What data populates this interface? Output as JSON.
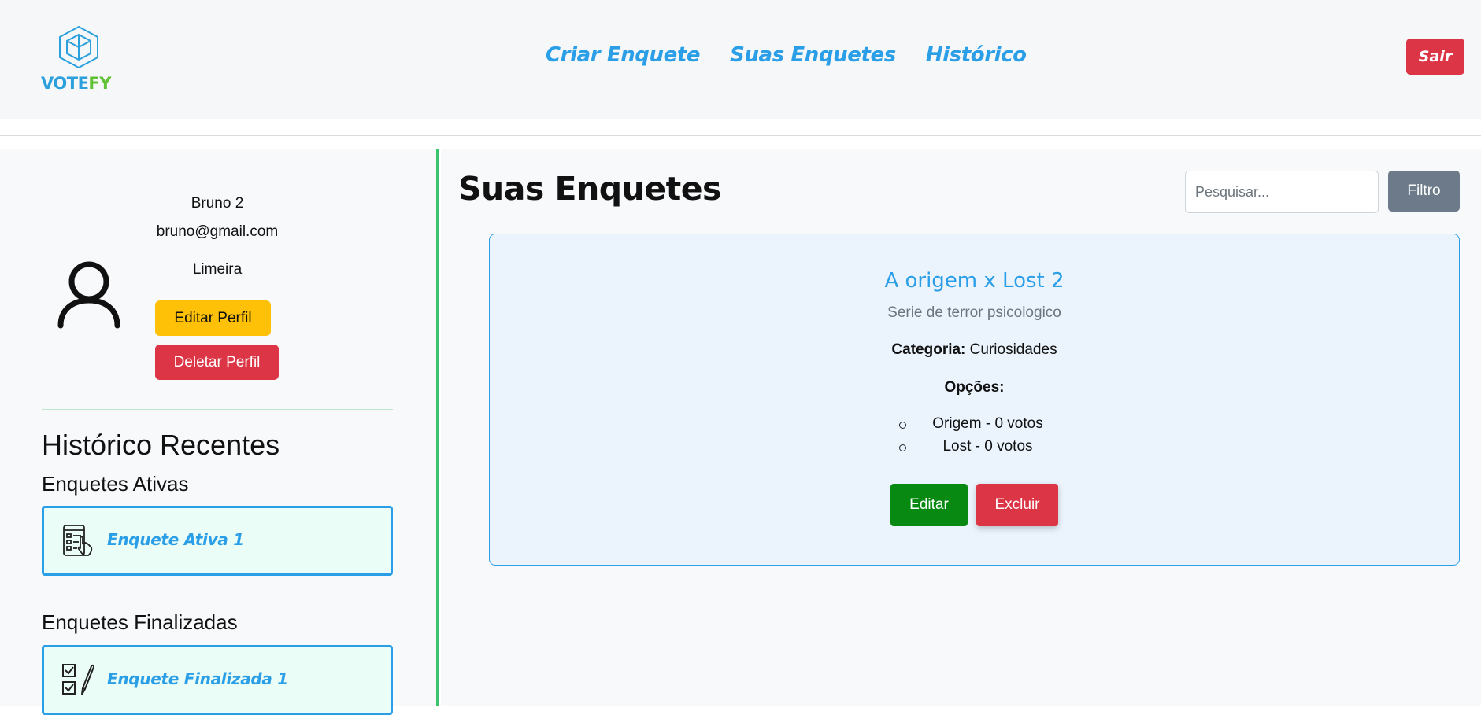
{
  "header": {
    "logo_prefix": "V",
    "logo_mid": "OTE",
    "logo_suffix": "FY",
    "nav": [
      {
        "label": "Criar Enquete"
      },
      {
        "label": "Suas Enquetes"
      },
      {
        "label": "Histórico"
      }
    ],
    "logout_label": "Sair"
  },
  "profile": {
    "name": "Bruno 2",
    "email": "bruno@gmail.com",
    "city": "Limeira",
    "edit_label": "Editar Perfil",
    "delete_label": "Deletar Perfil"
  },
  "history": {
    "title": "Histórico Recentes",
    "active_title": "Enquetes Ativas",
    "active_items": [
      {
        "label": "Enquete Ativa 1",
        "icon": "checklist-tablet-icon"
      }
    ],
    "finished_title": "Enquetes Finalizadas",
    "finished_items": [
      {
        "label": "Enquete Finalizada 1",
        "icon": "checklist-pencil-icon"
      }
    ]
  },
  "main": {
    "title": "Suas Enquetes",
    "search_placeholder": "Pesquisar...",
    "filter_label": "Filtro",
    "polls": [
      {
        "title": "A origem x Lost 2",
        "description": "Serie de terror psicologico",
        "category_label": "Categoria:",
        "category": "Curiosidades",
        "options_label": "Opções:",
        "options": [
          {
            "text": "Origem - 0 votos"
          },
          {
            "text": "Lost - 0 votos"
          }
        ],
        "edit_label": "Editar",
        "delete_label": "Excluir"
      }
    ]
  },
  "colors": {
    "accent": "#2a9ee6",
    "danger": "#dc3545",
    "warning": "#ffc107",
    "success": "#088a12",
    "logo_green": "#5fc234",
    "sidebar_border": "#3cc46c"
  }
}
